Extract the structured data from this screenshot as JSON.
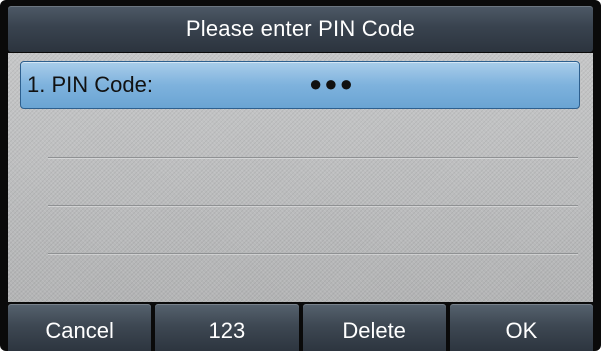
{
  "header": {
    "title": "Please enter PIN Code"
  },
  "fields": [
    {
      "label": "1. PIN Code:",
      "value": "●●●"
    }
  ],
  "softkeys": [
    {
      "label": "Cancel"
    },
    {
      "label": "123"
    },
    {
      "label": "Delete"
    },
    {
      "label": "OK"
    }
  ],
  "colors": {
    "title_bar": "#39434f",
    "selected_row": "#7eb2dd",
    "content_background": "#b9babb",
    "softkey": "#3e4853"
  }
}
